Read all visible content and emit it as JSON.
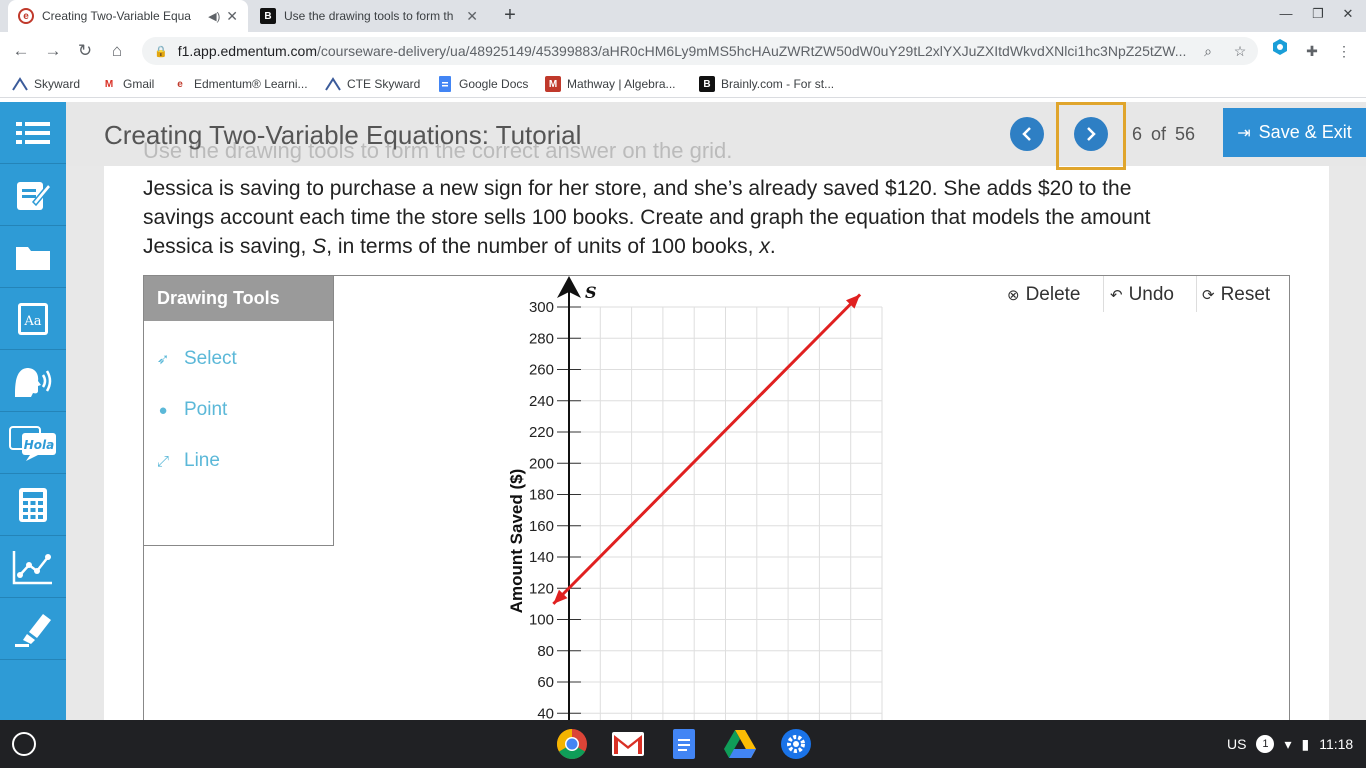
{
  "browser": {
    "tabs": [
      {
        "title": "Creating Two-Variable Equa",
        "active": true
      },
      {
        "title": "Use the drawing tools to form th",
        "active": false
      }
    ],
    "url_host": "f1.app.edmentum.com",
    "url_path": "/courseware-delivery/ua/48925149/45399883/aHR0cHM6Ly9mMS5hcHAuZWRtZW50dW0uY29tL2xlYXJuZXItdWkvdXNlci1hc3NpZ25tZW...",
    "bookmarks": [
      "Skyward",
      "Gmail",
      "Edmentum® Learni...",
      "CTE Skyward",
      "Google Docs",
      "Mathway | Algebra...",
      "Brainly.com - For st..."
    ]
  },
  "header": {
    "lesson_title": "Creating Two-Variable Equations: Tutorial",
    "ghost_instruction": "Use the drawing tools to form the correct answer on the grid.",
    "page_current": "6",
    "page_of": "of",
    "page_total": "56",
    "save_exit_label": "Save & Exit"
  },
  "question": {
    "line1": "Jessica is saving to purchase a new sign for her store, and she’s already saved $120. She adds $20 to the",
    "line2": "savings account each time the store sells 100 books. Create and graph the equation that models the amount",
    "line3_a": "Jessica is saving, ",
    "var_s": "S",
    "line3_b": ", in terms of the number of units of 100 books, ",
    "var_x": "x",
    "line3_c": "."
  },
  "tools": {
    "title": "Drawing Tools",
    "items": [
      "Select",
      "Point",
      "Line"
    ]
  },
  "controls": {
    "delete_label": "Delete",
    "undo_label": "Undo",
    "reset_label": "Reset"
  },
  "colors": {
    "sidebar": "#2e9bd6",
    "line": "#e02020",
    "accent": "#2e7fc4",
    "highlight": "#e0a52c"
  },
  "chart_data": {
    "type": "line",
    "ylabel": "Amount Saved ($)",
    "y_axis_var": "S",
    "yticks": [
      300,
      280,
      260,
      240,
      220,
      200,
      180,
      160,
      140,
      120,
      100,
      80,
      60,
      40
    ],
    "ylim": [
      40,
      300
    ],
    "grid": true,
    "series": [
      {
        "points": [
          {
            "x": -0.5,
            "y": 110
          },
          {
            "x": 9.3,
            "y": 308
          }
        ]
      }
    ]
  },
  "shelf": {
    "locale": "US",
    "notif_count": "1",
    "time": "11:18"
  }
}
